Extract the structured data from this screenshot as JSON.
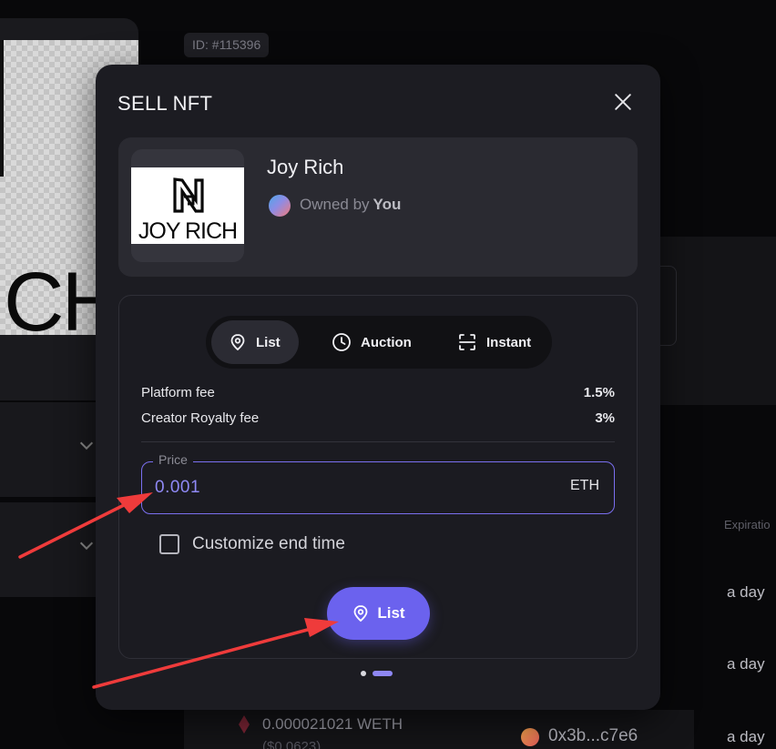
{
  "background": {
    "id_badge": "ID: #115396",
    "image_text": "CH",
    "expiration_label": "Expiratio",
    "rows": [
      {
        "time": "a day"
      },
      {
        "time": "a day"
      },
      {
        "time": "a day"
      }
    ],
    "last_row": {
      "amount": "0.000021021 WETH",
      "usd": "($0.0623)",
      "address": "0x3b...c7e6"
    }
  },
  "modal": {
    "title": "SELL NFT",
    "close_icon": "close-icon",
    "nft": {
      "name": "Joy Rich",
      "logo_text": "JOY RICH",
      "owner_prefix": "Owned by",
      "owner_name": "You"
    },
    "tabs": [
      {
        "label": "List",
        "icon": "tag-icon",
        "active": true
      },
      {
        "label": "Auction",
        "icon": "clock-icon",
        "active": false
      },
      {
        "label": "Instant",
        "icon": "scan-icon",
        "active": false
      }
    ],
    "fees": [
      {
        "label": "Platform fee",
        "value": "1.5%"
      },
      {
        "label": "Creator Royalty fee",
        "value": "3%"
      }
    ],
    "price": {
      "label": "Price",
      "value": "0.001",
      "unit": "ETH"
    },
    "customize_end_time": {
      "label": "Customize end time",
      "checked": false
    },
    "submit": {
      "label": "List",
      "icon": "tag-icon"
    },
    "pager": {
      "current": 2,
      "total": 2
    }
  },
  "colors": {
    "accent": "#6b62ee",
    "price_text": "#8f89f5",
    "annotation_arrow": "#ef3b3b",
    "modal_bg": "#1c1c22"
  }
}
